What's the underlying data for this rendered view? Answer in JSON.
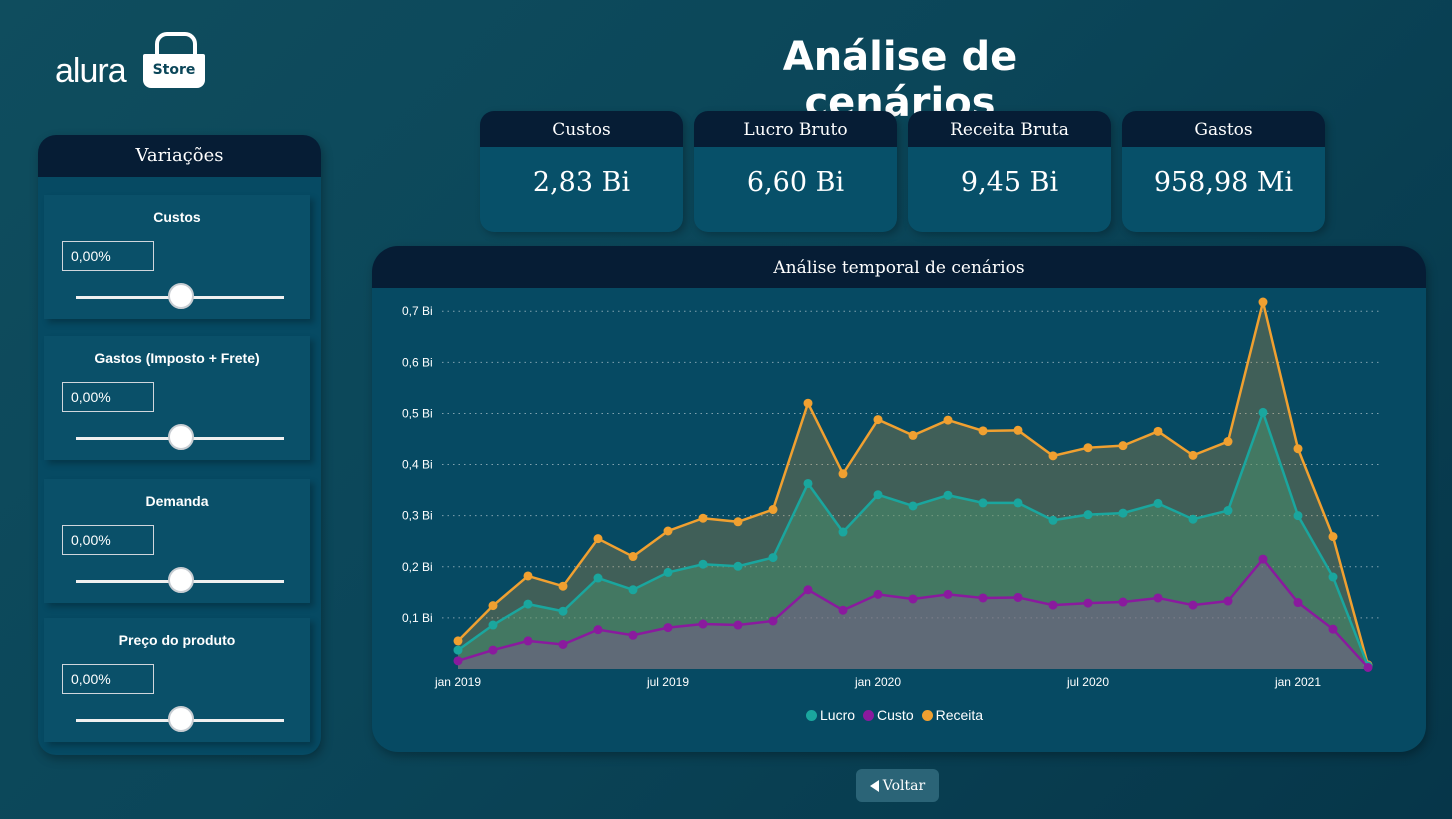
{
  "logo": {
    "brand": "alura",
    "badge": "Store"
  },
  "page_title": "Análise de cenários",
  "sidebar": {
    "title": "Variações",
    "variations": [
      {
        "label": "Custos",
        "value": "0,00%",
        "slider_level": 0.5
      },
      {
        "label": "Gastos (Imposto + Frete)",
        "value": "0,00%",
        "slider_level": 0.5
      },
      {
        "label": "Demanda",
        "value": "0,00%",
        "slider_level": 0.5
      },
      {
        "label": "Preço do produto",
        "value": "0,00%",
        "slider_level": 0.5
      }
    ]
  },
  "kpis": [
    {
      "title": "Custos",
      "value": "2,83 Bi"
    },
    {
      "title": "Lucro Bruto",
      "value": "6,60 Bi"
    },
    {
      "title": "Receita Bruta",
      "value": "9,45 Bi"
    },
    {
      "title": "Gastos",
      "value": "958,98 Mi"
    }
  ],
  "chart_card": {
    "title": "Análise temporal de cenários"
  },
  "chart_data": {
    "type": "area",
    "title": "Análise temporal de cenários",
    "x": [
      "2019-01",
      "2019-02",
      "2019-03",
      "2019-04",
      "2019-05",
      "2019-06",
      "2019-07",
      "2019-08",
      "2019-09",
      "2019-10",
      "2019-11",
      "2019-12",
      "2020-01",
      "2020-02",
      "2020-03",
      "2020-04",
      "2020-05",
      "2020-06",
      "2020-07",
      "2020-08",
      "2020-09",
      "2020-10",
      "2020-11",
      "2020-12",
      "2021-01",
      "2021-02",
      "2021-03"
    ],
    "x_ticks": [
      "jan 2019",
      "jul 2019",
      "jan 2020",
      "jul 2020",
      "jan 2021"
    ],
    "y_ticks": [
      "0,1 Bi",
      "0,2 Bi",
      "0,3 Bi",
      "0,4 Bi",
      "0,5 Bi",
      "0,6 Bi",
      "0,7 Bi"
    ],
    "ylim": [
      0,
      0.72
    ],
    "y_unit": "Bi",
    "grid": true,
    "legend_position": "bottom-center",
    "series": [
      {
        "name": "Receita",
        "color": "#f0a030",
        "values": [
          0.055,
          0.124,
          0.182,
          0.162,
          0.255,
          0.22,
          0.27,
          0.295,
          0.288,
          0.312,
          0.52,
          0.382,
          0.488,
          0.457,
          0.487,
          0.466,
          0.467,
          0.417,
          0.433,
          0.437,
          0.465,
          0.418,
          0.445,
          0.718,
          0.431,
          0.259,
          0.008
        ]
      },
      {
        "name": "Lucro",
        "color": "#1aa69e",
        "values": [
          0.037,
          0.086,
          0.127,
          0.113,
          0.178,
          0.155,
          0.189,
          0.205,
          0.201,
          0.218,
          0.363,
          0.268,
          0.341,
          0.319,
          0.34,
          0.325,
          0.325,
          0.291,
          0.302,
          0.305,
          0.324,
          0.293,
          0.31,
          0.502,
          0.3,
          0.18,
          0.006
        ]
      },
      {
        "name": "Custo",
        "color": "#8a1a9e",
        "values": [
          0.016,
          0.037,
          0.055,
          0.048,
          0.077,
          0.066,
          0.081,
          0.088,
          0.086,
          0.094,
          0.155,
          0.115,
          0.146,
          0.137,
          0.146,
          0.139,
          0.14,
          0.125,
          0.129,
          0.131,
          0.139,
          0.125,
          0.133,
          0.215,
          0.13,
          0.078,
          0.003
        ]
      }
    ]
  },
  "legend_order": [
    {
      "name": "Lucro",
      "color": "#1aa69e"
    },
    {
      "name": "Custo",
      "color": "#8a1a9e"
    },
    {
      "name": "Receita",
      "color": "#f0a030"
    }
  ],
  "back_button": {
    "label": "Voltar"
  }
}
